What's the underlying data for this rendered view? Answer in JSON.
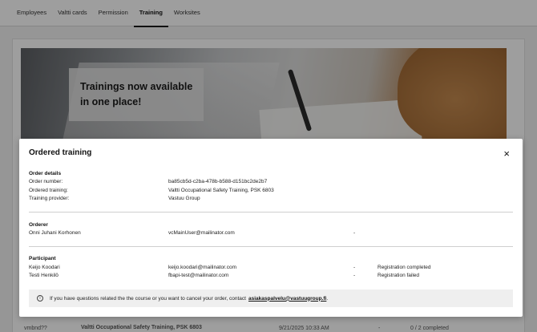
{
  "tabs": [
    {
      "label": "Employees"
    },
    {
      "label": "Valtti cards"
    },
    {
      "label": "Permission"
    },
    {
      "label": "Training",
      "active": true
    },
    {
      "label": "Worksites"
    }
  ],
  "hero": {
    "line1": "Trainings now available",
    "line2": "in one place!"
  },
  "background_row": {
    "code": "vmbnd??",
    "training": "Valtti Occupational Safety Training, PSK 6803",
    "date": "9/21/2025 10:33 AM",
    "dash": "-",
    "status": "0 / 2 completed"
  },
  "modal": {
    "title": "Ordered training",
    "close_icon": "×",
    "order_details": {
      "heading": "Order details",
      "rows": [
        {
          "label": "Order number:",
          "value": "ba85cb5d-c2ba-478b-b588-d151bc2de2b7"
        },
        {
          "label": "Ordered training:",
          "value": "Valtti Occupational Safety Training, PSK 6803"
        },
        {
          "label": "Training provider:",
          "value": "Vastuu Group"
        }
      ]
    },
    "orderer": {
      "heading": "Orderer",
      "name": "Onni Juhani Korhonen",
      "email": "vcMainUser@mailinator.com",
      "dash": "-"
    },
    "participant": {
      "heading": "Participant",
      "rows": [
        {
          "name": "Keijo Koodari",
          "email": "keijo.koodari@mailinator.com",
          "dash": "-",
          "status": "Registration completed"
        },
        {
          "name": "Testi Henkilö",
          "email": "fbapi-test@mailinator.com",
          "dash": "-",
          "status": "Registration failed"
        }
      ]
    },
    "info": {
      "icon": "i",
      "text": "If you have questions related the the course or you want to cancel your order, contact",
      "link": "asiakaspalvelu@vastuugroup.fi",
      "suffix": "."
    }
  }
}
